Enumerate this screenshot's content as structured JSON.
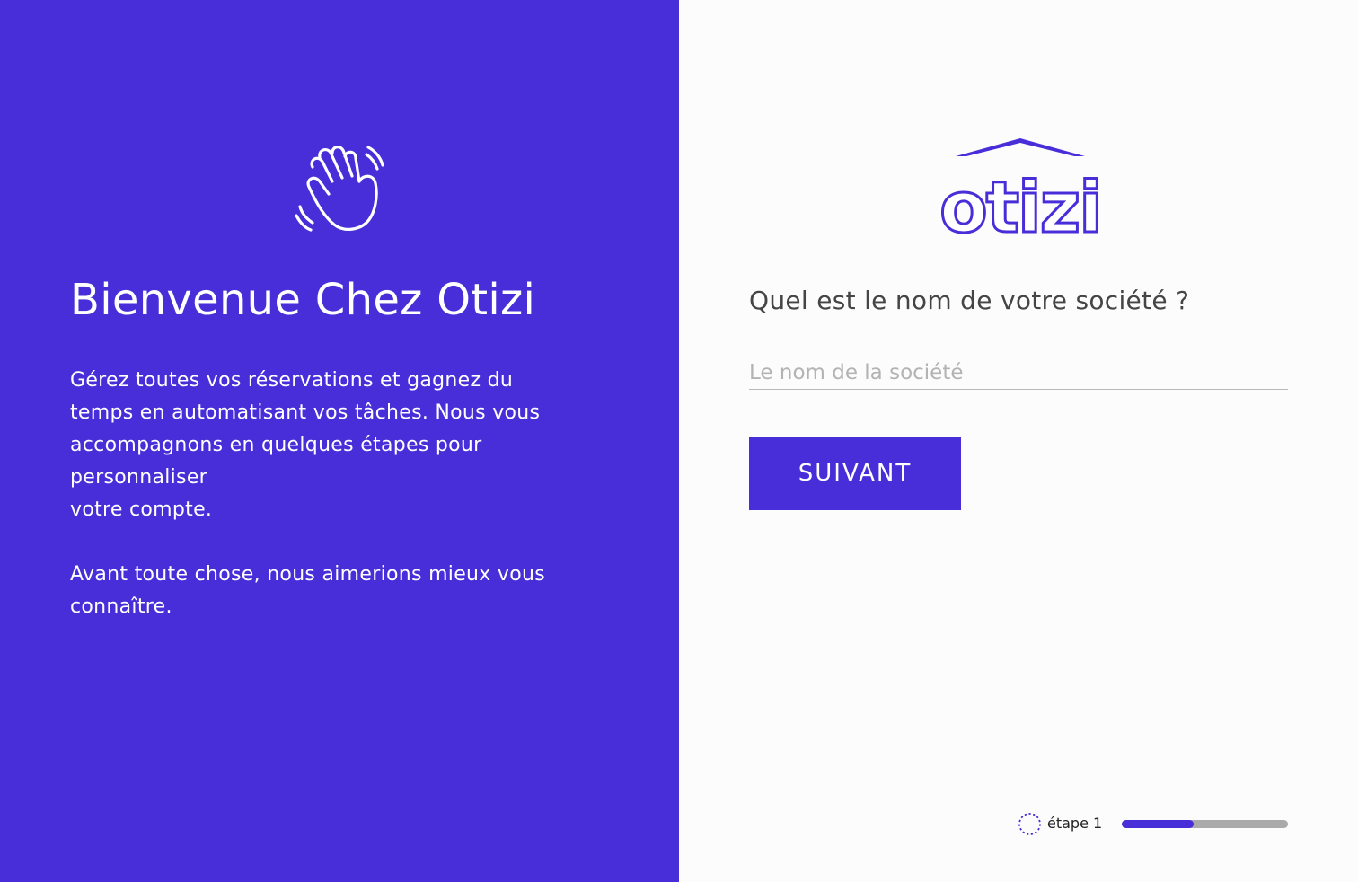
{
  "colors": {
    "brand": "#482ed8",
    "right_background": "#fcfcfc",
    "question_text": "#454545",
    "placeholder_text": "#b3b3b3",
    "progress_track": "#aaaaaa"
  },
  "left_panel": {
    "icon": "waving-hand-icon",
    "title": "Bienvenue Chez Otizi",
    "intro_line1": "Gérez toutes vos réservations et gagnez du",
    "intro_line2": "temps en automatisant vos tâches. Nous vous",
    "intro_line3": "accompagnons en quelques étapes pour",
    "intro_line4": "personnaliser",
    "intro_line5": "votre compte.",
    "intro_para2_line1": "Avant toute chose, nous aimerions mieux vous",
    "intro_para2_line2": "connaître."
  },
  "right_panel": {
    "logo_text": "otizi",
    "question": "Quel est le nom de votre société  ?",
    "company_input": {
      "value": "",
      "placeholder": "Le nom de la société"
    },
    "next_label": "SUIVANT",
    "step": {
      "icon": "dotted-circle-icon",
      "label": "étape 1",
      "progress": 0.43
    }
  }
}
